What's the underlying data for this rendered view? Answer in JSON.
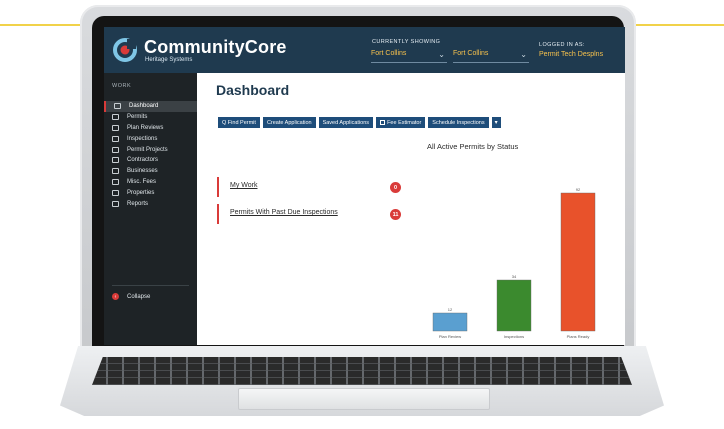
{
  "header": {
    "brand": "CommunityCore",
    "brand_sub": "Heritage Systems",
    "currently_showing_label": "CURRENTLY SHOWING",
    "location_primary": "Fort Collins",
    "location_secondary": "Fort Collins",
    "logged_in_label": "LOGGED IN AS:",
    "user": "Permit Tech Desplns",
    "chevron": "⌄"
  },
  "sidebar": {
    "section": "WORK",
    "items": [
      {
        "label": "Dashboard",
        "icon": "dashboard-icon",
        "active": true
      },
      {
        "label": "Permits",
        "icon": "permits-icon"
      },
      {
        "label": "Plan Reviews",
        "icon": "plan-reviews-icon"
      },
      {
        "label": "Inspections",
        "icon": "inspections-icon"
      },
      {
        "label": "Permit Projects",
        "icon": "permit-projects-icon"
      },
      {
        "label": "Contractors",
        "icon": "contractors-icon"
      },
      {
        "label": "Businesses",
        "icon": "businesses-icon"
      },
      {
        "label": "Misc. Fees",
        "icon": "misc-fees-icon"
      },
      {
        "label": "Properties",
        "icon": "properties-icon"
      },
      {
        "label": "Reports",
        "icon": "reports-icon"
      }
    ],
    "collapse_label": "Collapse"
  },
  "main": {
    "title": "Dashboard",
    "toolbar": {
      "find_permit": "Q Find Permit",
      "create_application": "Create Application",
      "saved_applications": "Saved Applications",
      "fee_estimator": "Fee Estimator",
      "schedule_inspections": "Schedule Inspections",
      "caret": "▾"
    },
    "work_items": [
      {
        "label": "My Work",
        "count": "0"
      },
      {
        "label": "Permits With Past Due Inspections",
        "count": "11"
      }
    ]
  },
  "colors": {
    "header_bg": "#1f3a4f",
    "accent_red": "#d93b39",
    "button_blue": "#1e4d7a",
    "user_gold": "#f7c24d"
  },
  "chart_data": {
    "type": "bar",
    "title": "All Active Permits by Status",
    "categories": [
      "Plan Review",
      "Inspections",
      "Plans Ready"
    ],
    "values": [
      12,
      34,
      92
    ],
    "colors": [
      "#5a9fd0",
      "#3b8a2e",
      "#e8522b"
    ],
    "ylim": [
      0,
      100
    ]
  }
}
